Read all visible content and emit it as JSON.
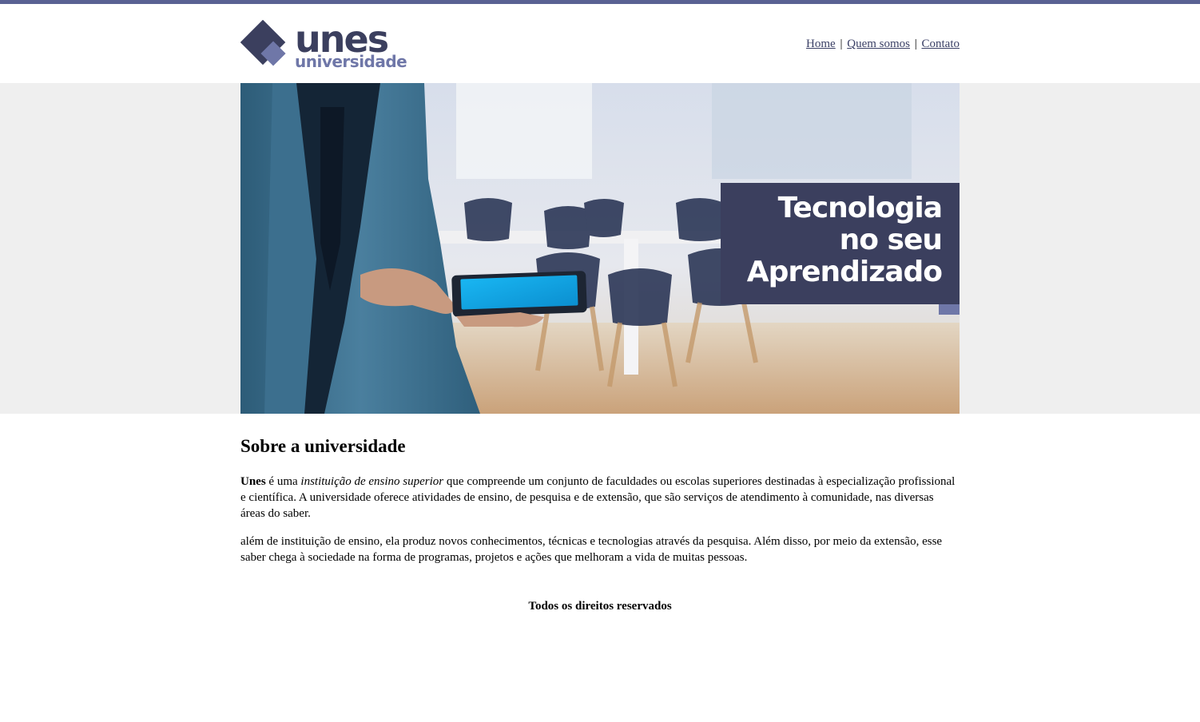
{
  "header": {
    "logo": {
      "title": "unes",
      "subtitle": "universidade"
    },
    "nav": [
      {
        "label": "Home"
      },
      {
        "label": "Quem somos"
      },
      {
        "label": "Contato"
      }
    ],
    "separator": "|"
  },
  "banner": {
    "caption_lines": [
      "Tecnologia",
      "no seu",
      "Aprendizado"
    ]
  },
  "main": {
    "heading": "Sobre a universidade",
    "para1": {
      "brand": "Unes",
      "text_a": " é uma ",
      "emphasis": "instituição de ensino superior",
      "text_b": " que compreende um conjunto de faculdades ou escolas superiores destinadas à especialização profissional e científica. A universidade oferece atividades de ensino, de pesquisa e de extensão, que são serviços de atendimento à comunidade, nas diversas áreas do saber."
    },
    "para2": "além de instituição de ensino, ela produz novos conhecimentos, técnicas e tecnologias através da pesquisa. Além disso, por meio da extensão, esse saber chega à sociedade na forma de programas, projetos e ações que melhoram a vida de muitas pessoas."
  },
  "footer": {
    "text": "Todos os direitos reservados"
  },
  "colors": {
    "topbar": "#5a6293",
    "logo_dark": "#3b3f5e",
    "logo_light": "#6f77a8",
    "caption_bg": "#3b3f5e",
    "banner_page_bg": "#efefef"
  }
}
